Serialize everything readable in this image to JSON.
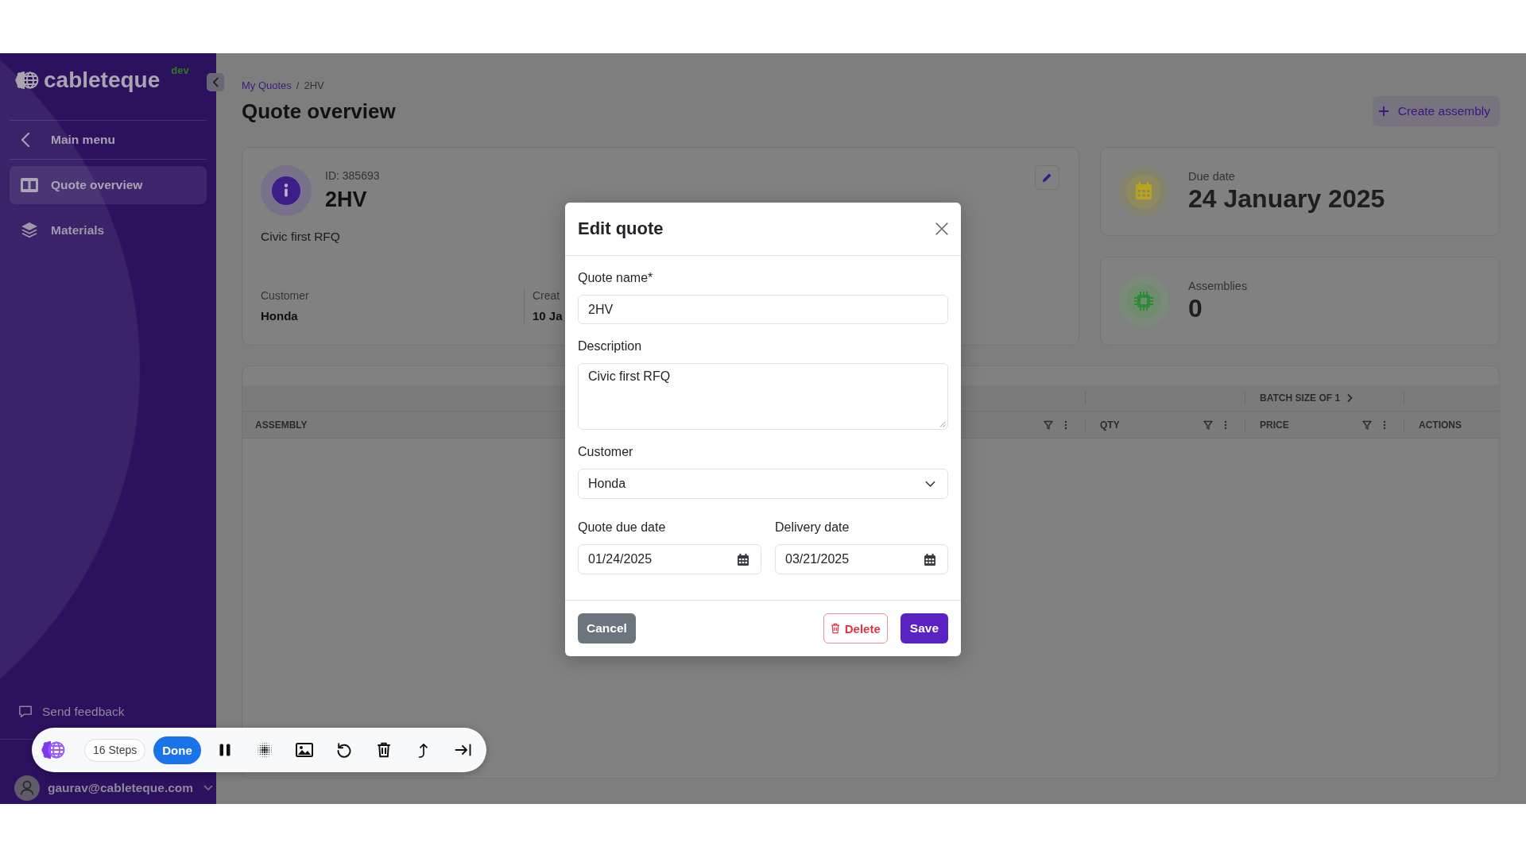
{
  "sidebar": {
    "logo": {
      "name": "cableteque",
      "badge": "dev"
    },
    "back_link": {
      "label": "Main menu"
    },
    "items": [
      {
        "label": "Quote overview",
        "selected": true
      },
      {
        "label": "Materials",
        "selected": false
      }
    ],
    "feedback_link": {
      "label": "Send feedback"
    },
    "user": {
      "email": "gaurav@cableteque.com"
    }
  },
  "breadcrumb": {
    "items": [
      {
        "label": "My Quotes",
        "kind": "link"
      },
      {
        "label": "2HV",
        "kind": "current"
      }
    ],
    "separator": "/"
  },
  "page_title": "Quote overview",
  "create_button": {
    "label": "Create assembly"
  },
  "quote_card": {
    "id_label": "ID: 385693",
    "name": "2HV",
    "description": "Civic first RFQ",
    "fields": [
      {
        "label": "Customer",
        "value": "Honda"
      },
      {
        "label": "Creat",
        "value": "10 Ja"
      }
    ]
  },
  "stat_cards": [
    {
      "kind": "date",
      "label": "Due date",
      "value": "24 January 2025"
    },
    {
      "kind": "count",
      "label": "Assemblies",
      "value": "0"
    }
  ],
  "table": {
    "columns": [
      {
        "label": "ASSEMBLY",
        "filterable": false
      },
      {
        "filterable": true
      },
      {
        "label": "QTY",
        "filterable": true
      },
      {
        "label": "PRICE",
        "filterable": true,
        "group_label": "BATCH SIZE OF 1"
      },
      {
        "label": "ACTIONS",
        "filterable": false
      }
    ]
  },
  "modal": {
    "title": "Edit quote",
    "fields": [
      {
        "kind": "text",
        "label": "Quote name*",
        "value": "2HV"
      },
      {
        "kind": "textarea",
        "label": "Description",
        "value": "Civic first RFQ"
      },
      {
        "kind": "select",
        "label": "Customer",
        "value": "Honda"
      }
    ],
    "date_fields": [
      {
        "label": "Quote due date",
        "value": "01/24/2025"
      },
      {
        "label": "Delivery date",
        "value": "03/21/2025"
      }
    ],
    "buttons": [
      {
        "kind": "secondary",
        "label": "Cancel"
      },
      {
        "kind": "danger",
        "label": "Delete"
      },
      {
        "kind": "primary",
        "label": "Save"
      }
    ]
  },
  "recorder": {
    "steps_label": "16 Steps",
    "done_label": "Done"
  }
}
